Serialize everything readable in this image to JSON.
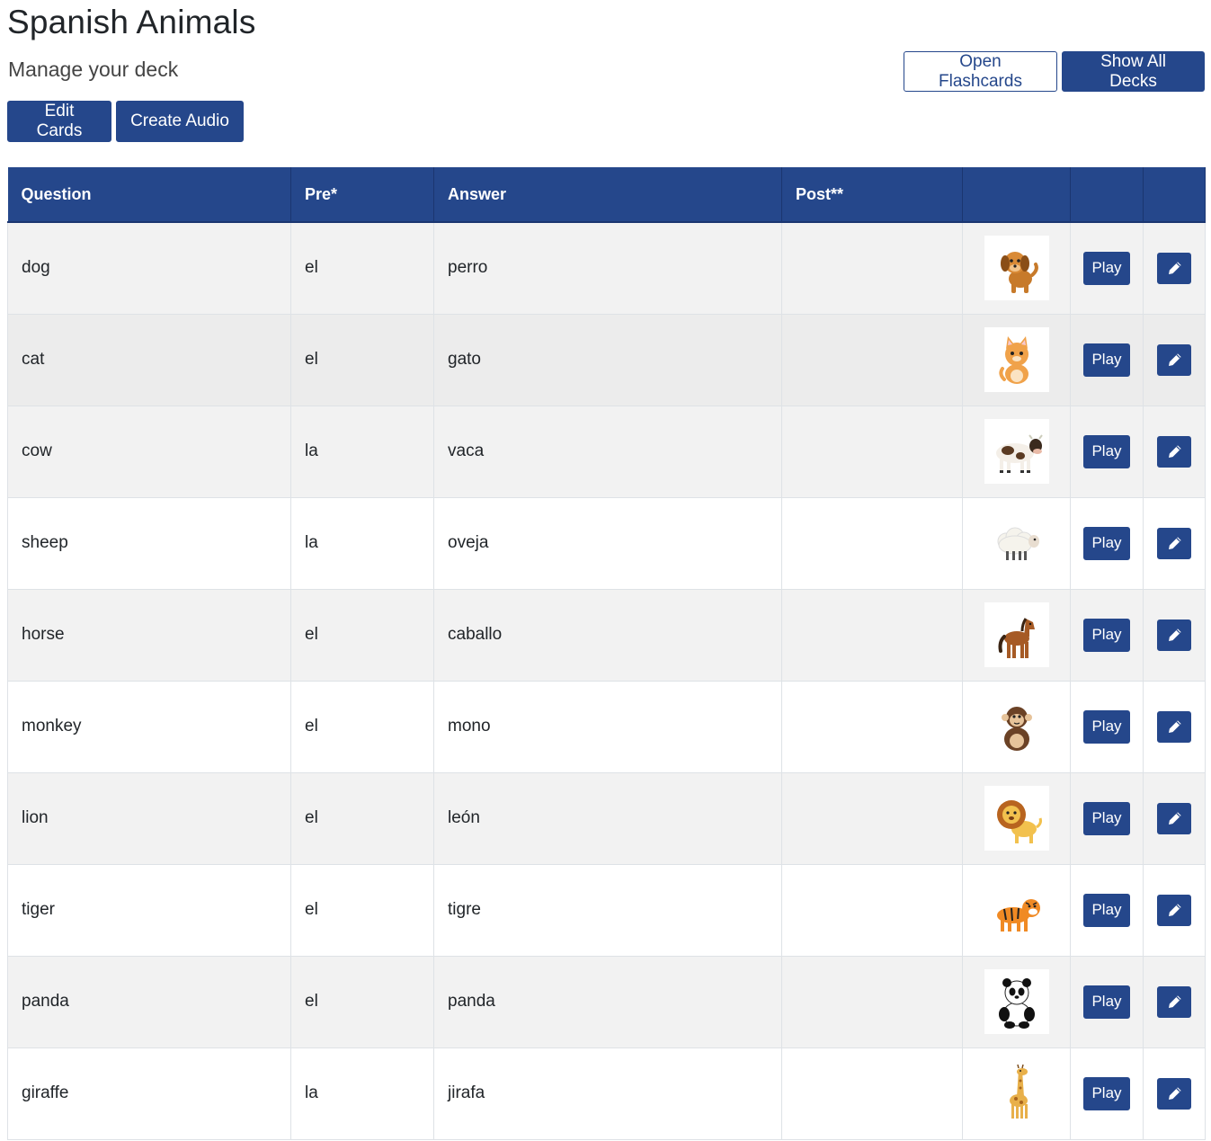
{
  "header": {
    "title": "Spanish Animals",
    "subtitle": "Manage your deck"
  },
  "buttons": {
    "edit_cards": "Edit Cards",
    "create_audio": "Create Audio",
    "open_flashcards": "Open Flashcards",
    "show_all_decks": "Show All Decks"
  },
  "colors": {
    "primary": "#25478b",
    "row_stripe": "#f2f2f2"
  },
  "table": {
    "columns": [
      "Question",
      "Pre*",
      "Answer",
      "Post**",
      "",
      "",
      ""
    ],
    "play_label": "Play",
    "rows": [
      {
        "question": "dog",
        "pre": "el",
        "answer": "perro",
        "post": "",
        "image_icon": "dog-icon"
      },
      {
        "question": "cat",
        "pre": "el",
        "answer": "gato",
        "post": "",
        "image_icon": "cat-icon"
      },
      {
        "question": "cow",
        "pre": "la",
        "answer": "vaca",
        "post": "",
        "image_icon": "cow-icon"
      },
      {
        "question": "sheep",
        "pre": "la",
        "answer": "oveja",
        "post": "",
        "image_icon": "sheep-icon"
      },
      {
        "question": "horse",
        "pre": "el",
        "answer": "caballo",
        "post": "",
        "image_icon": "horse-icon"
      },
      {
        "question": "monkey",
        "pre": "el",
        "answer": "mono",
        "post": "",
        "image_icon": "monkey-icon"
      },
      {
        "question": "lion",
        "pre": "el",
        "answer": "león",
        "post": "",
        "image_icon": "lion-icon"
      },
      {
        "question": "tiger",
        "pre": "el",
        "answer": "tigre",
        "post": "",
        "image_icon": "tiger-icon"
      },
      {
        "question": "panda",
        "pre": "el",
        "answer": "panda",
        "post": "",
        "image_icon": "panda-icon"
      },
      {
        "question": "giraffe",
        "pre": "la",
        "answer": "jirafa",
        "post": "",
        "image_icon": "giraffe-icon"
      }
    ]
  }
}
